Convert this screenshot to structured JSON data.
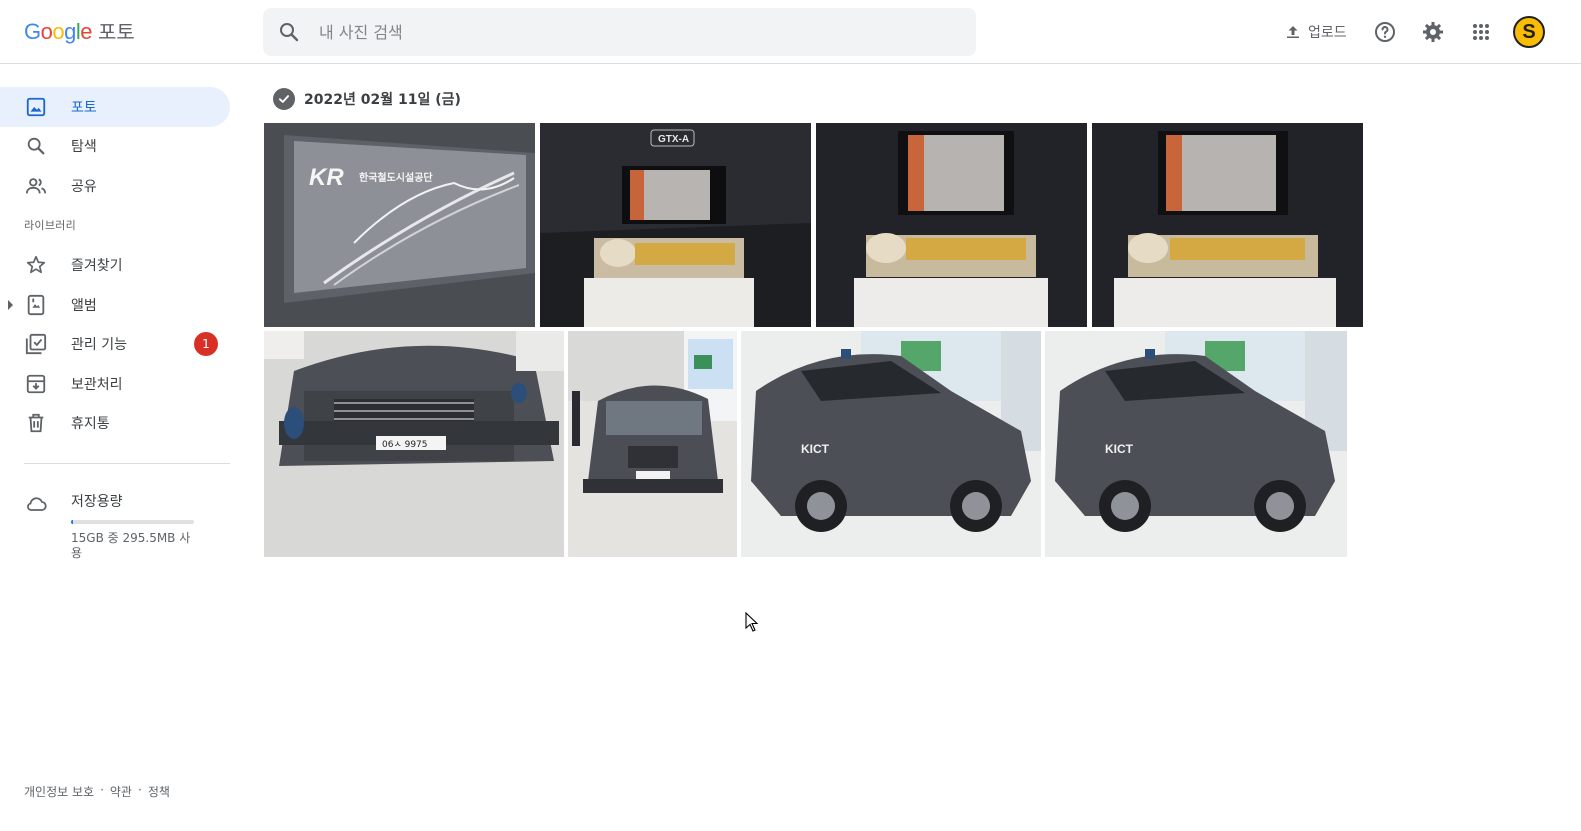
{
  "app": {
    "logo_word": "Google",
    "logo_product": "포토"
  },
  "search": {
    "placeholder": "내 사진 검색"
  },
  "toolbar": {
    "upload_label": "업로드",
    "avatar_initial": "S"
  },
  "sidebar": {
    "items": [
      {
        "label": "포토",
        "icon": "photo-icon",
        "active": true
      },
      {
        "label": "탐색",
        "icon": "search-icon"
      },
      {
        "label": "공유",
        "icon": "people-icon"
      }
    ],
    "library_label": "라이브러리",
    "library_items": [
      {
        "label": "즐겨찾기",
        "icon": "star-icon"
      },
      {
        "label": "앨범",
        "icon": "album-icon"
      },
      {
        "label": "관리 기능",
        "icon": "checklist-icon",
        "badge": "1"
      },
      {
        "label": "보관처리",
        "icon": "archive-icon"
      },
      {
        "label": "휴지통",
        "icon": "trash-icon"
      }
    ],
    "storage": {
      "title": "저장용량",
      "usage_text": "15GB 중 295.5MB 사용",
      "used_fraction": 0.02
    }
  },
  "footer": {
    "privacy": "개인정보 보호",
    "terms": "약관",
    "policy": "정책",
    "sep": "·"
  },
  "main": {
    "date_group": "2022년 02월 11일 (금)",
    "photos": [
      {
        "subject": "kr-rail-bridge-banner",
        "text": "한국철도시설공단"
      },
      {
        "subject": "gtx-a-tbm-model",
        "text": "GTX-A"
      },
      {
        "subject": "tbm-model"
      },
      {
        "subject": "tbm-model"
      },
      {
        "subject": "suv-front-closeup",
        "plate": "06ㅅ 9975"
      },
      {
        "subject": "suv-front-booth"
      },
      {
        "subject": "suv-side-kict",
        "text": "KICT"
      },
      {
        "subject": "suv-side-kict",
        "text": "KICT"
      }
    ]
  },
  "colors": {
    "accent": "#1967d2",
    "active_bg": "#e8f0fe",
    "badge": "#d93025",
    "avatar": "#fbbc04"
  }
}
